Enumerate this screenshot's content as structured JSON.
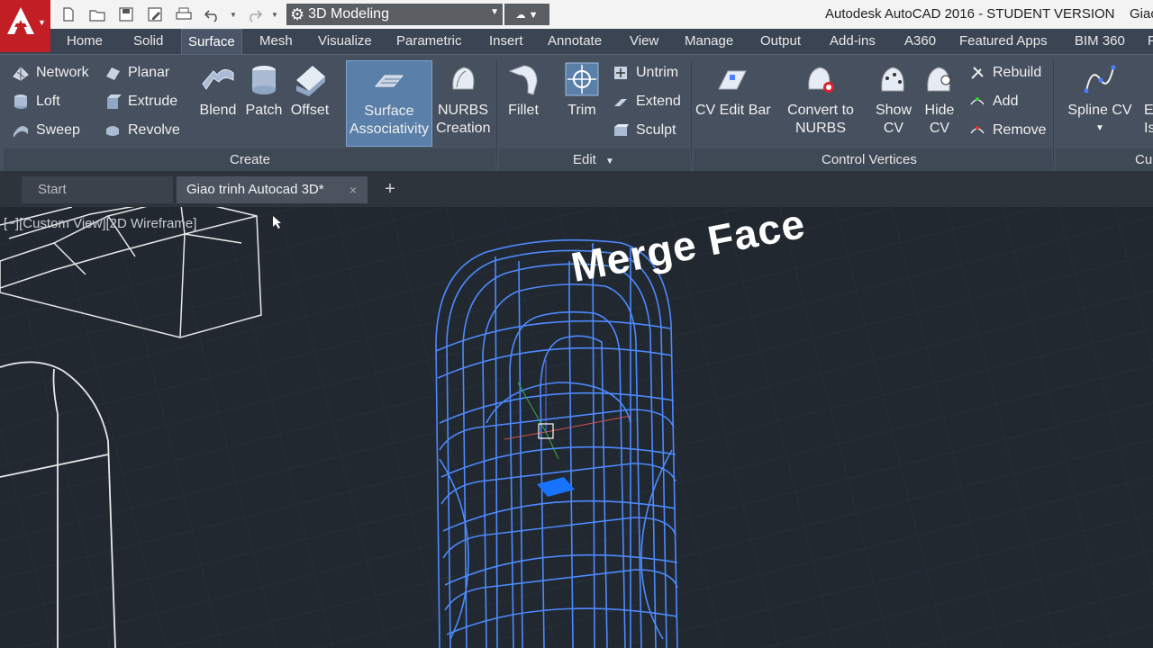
{
  "title_bar": {
    "window_title": "Autodesk AutoCAD 2016 - STUDENT VERSION",
    "window_title_extra": "Giao",
    "workspace": "3D Modeling",
    "quick_access": [
      "new-icon",
      "open-icon",
      "save-icon",
      "save-as-icon",
      "plot-icon",
      "undo-icon",
      "redo-icon"
    ]
  },
  "ribbon_tabs": [
    "Home",
    "Solid",
    "Surface",
    "Mesh",
    "Visualize",
    "Parametric",
    "Insert",
    "Annotate",
    "View",
    "Manage",
    "Output",
    "Add-ins",
    "A360",
    "Featured Apps",
    "BIM 360",
    "P"
  ],
  "active_tab": "Surface",
  "ribbon": {
    "create": {
      "title": "Create",
      "small_tools": [
        "Network",
        "Loft",
        "Sweep",
        "Planar",
        "Extrude",
        "Revolve"
      ],
      "blend": "Blend",
      "patch": "Patch",
      "offset": "Offset",
      "surface_assoc_1": "Surface",
      "surface_assoc_2": "Associativity",
      "nurbs_1": "NURBS",
      "nurbs_2": "Creation"
    },
    "edit": {
      "title": "Edit",
      "fillet": "Fillet",
      "trim": "Trim",
      "small_tools": [
        "Untrim",
        "Extend",
        "Sculpt"
      ]
    },
    "control_vertices": {
      "title": "Control Vertices",
      "cv_edit_bar": "CV Edit Bar",
      "convert_1": "Convert to",
      "convert_2": "NURBS",
      "show_1": "Show",
      "show_2": "CV",
      "hide_1": "Hide",
      "hide_2": "CV",
      "small_tools": [
        "Rebuild",
        "Add",
        "Remove"
      ]
    },
    "curves": {
      "title": "Cu",
      "spline_cv": "Spline CV",
      "cut_1": "E",
      "cut_2": "Is"
    }
  },
  "doc_tabs": {
    "start": "Start",
    "active": "Giao trinh Autocad 3D*",
    "close": "×",
    "add": "+"
  },
  "viewport": {
    "view_label": "[−][Custom View][2D Wireframe]",
    "annotation": "Merge Face"
  },
  "colors": {
    "accent_blue": "#5a7fa8",
    "wireframe_blue": "#3f7fff",
    "viewport_bg": "#212830",
    "ribbon_bg": "#46505e"
  }
}
